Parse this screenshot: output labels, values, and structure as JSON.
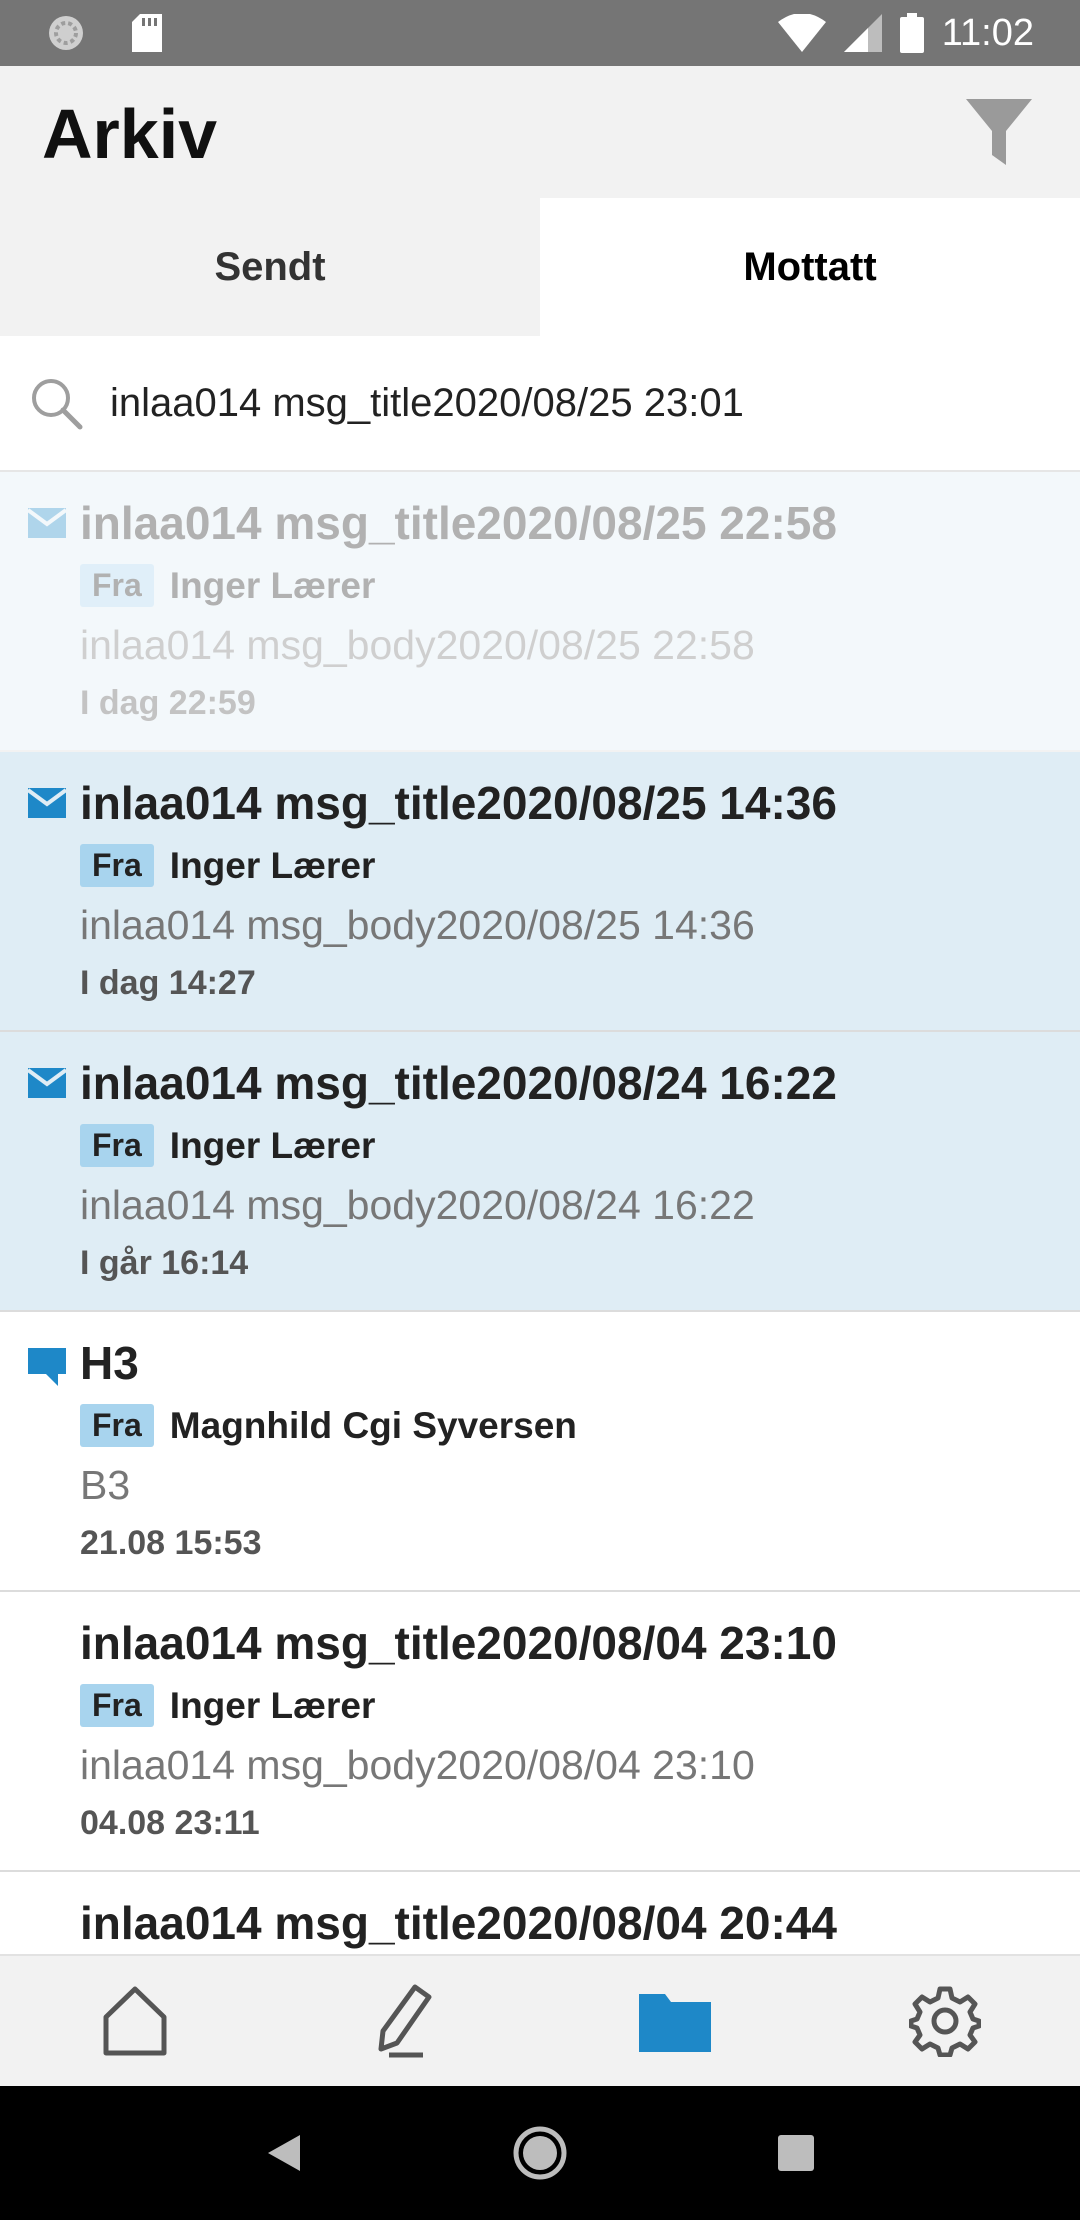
{
  "status_bar": {
    "time": "11:02"
  },
  "header": {
    "title": "Arkiv",
    "filter_icon": "filter-icon"
  },
  "tabs": [
    {
      "label": "Sendt",
      "active": false
    },
    {
      "label": "Mottatt",
      "active": true
    }
  ],
  "search": {
    "value": "inlaa014 msg_title2020/08/25 23:01",
    "icon": "search-icon"
  },
  "messages": [
    {
      "title": "inlaa014 msg_title2020/08/25 22:58",
      "from_label": "Fra",
      "sender": "Inger Lærer",
      "body": "inlaa014 msg_body2020/08/25 22:58",
      "time": "I dag 22:59",
      "icon": "envelope-icon",
      "unread": true,
      "faded": true
    },
    {
      "title": "inlaa014 msg_title2020/08/25 14:36",
      "from_label": "Fra",
      "sender": "Inger Lærer",
      "body": "inlaa014 msg_body2020/08/25 14:36",
      "time": "I dag 14:27",
      "icon": "envelope-icon",
      "unread": true,
      "faded": false
    },
    {
      "title": "inlaa014 msg_title2020/08/24 16:22",
      "from_label": "Fra",
      "sender": "Inger Lærer",
      "body": "inlaa014 msg_body2020/08/24 16:22",
      "time": "I går 16:14",
      "icon": "envelope-icon",
      "unread": true,
      "faded": false
    },
    {
      "title": "H3",
      "from_label": "Fra",
      "sender": "Magnhild Cgi Syversen",
      "body": "B3",
      "time": "21.08 15:53",
      "icon": "chat-bubble-icon",
      "unread": false,
      "faded": false
    },
    {
      "title": "inlaa014 msg_title2020/08/04 23:10",
      "from_label": "Fra",
      "sender": "Inger Lærer",
      "body": "inlaa014 msg_body2020/08/04 23:10",
      "time": "04.08 23:11",
      "icon": "",
      "unread": false,
      "faded": false
    },
    {
      "title": "inlaa014 msg_title2020/08/04 20:44",
      "from_label": "",
      "sender": "",
      "body": "",
      "time": "",
      "icon": "",
      "unread": false,
      "faded": false
    }
  ],
  "bottom_nav": [
    {
      "icon": "home-icon",
      "active": false
    },
    {
      "icon": "pen-icon",
      "active": false
    },
    {
      "icon": "folder-icon",
      "active": true
    },
    {
      "icon": "gear-icon",
      "active": false
    }
  ],
  "colors": {
    "accent": "#1e88c8",
    "unread_bg": "#dfedf5",
    "badge": "#a8d4ee"
  }
}
